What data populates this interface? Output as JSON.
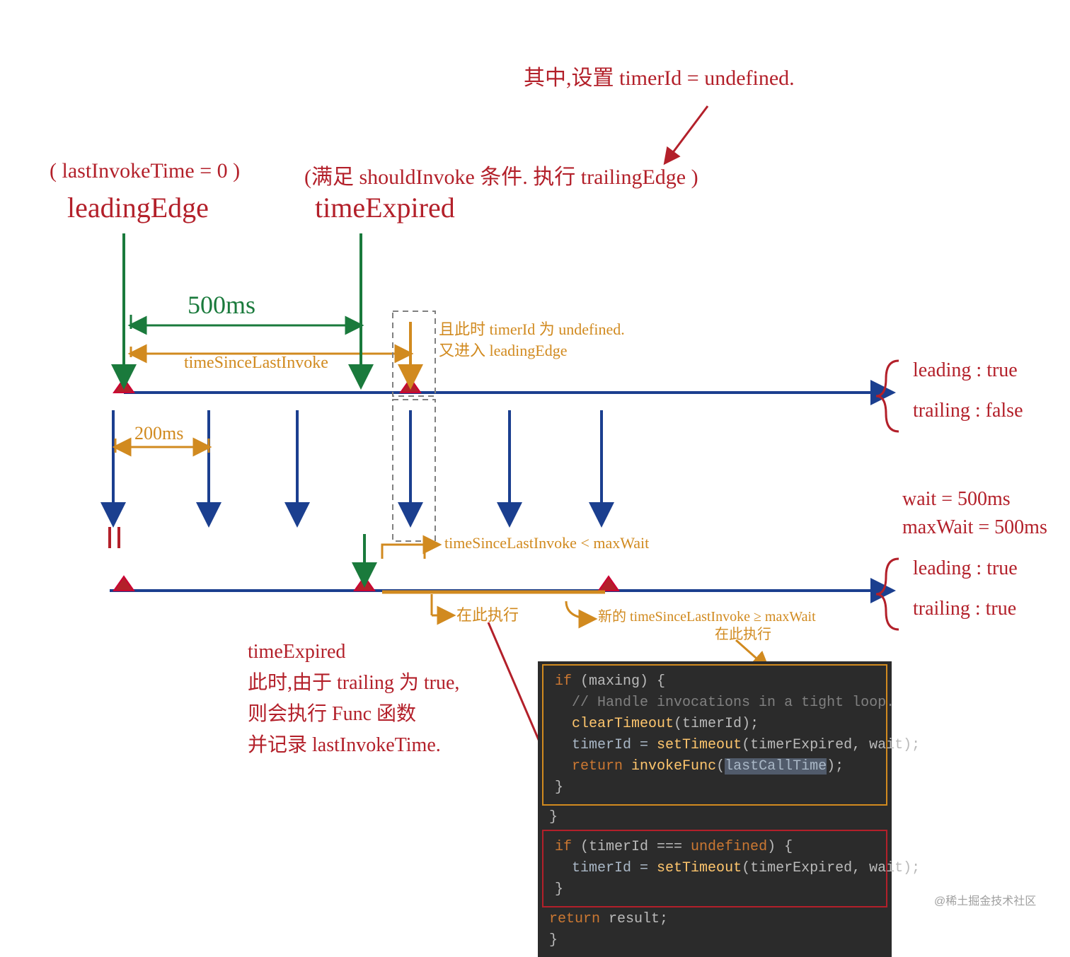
{
  "annotations": {
    "top_right": "其中,设置 timerId = undefined.",
    "left_cond": "( lastInvokeTime = 0 )",
    "leading_edge": "leadingEdge",
    "mid_cond": "(满足 shouldInvoke 条件. 执行 trailingEdge )",
    "time_expired": "timeExpired",
    "duration_500": "500ms",
    "since_invoke": "timeSinceLastInvoke",
    "orange_top_1": "且此时 timerId 为 undefined.",
    "orange_top_2": "又进入 leadingEdge",
    "duration_200": "200ms",
    "since_lt_max": "timeSinceLastInvoke < maxWait",
    "exec_here_1": "在此执行",
    "since_ge_max": "新的 timeSinceLastInvoke ≥ maxWait",
    "exec_here_2": "在此执行",
    "bottom_note": "timeExpired\n此时,由于 trailing 为 true,\n则会执行 Func 函数\n并记录 lastInvokeTime.",
    "brace_top_1": "leading : true",
    "brace_top_2": "trailing : false",
    "wait_line": "wait = 500ms",
    "maxwait_line": "maxWait = 500ms",
    "brace_bot_1": "leading : true",
    "brace_bot_2": "trailing : true"
  },
  "code": {
    "l1_if": "if",
    "l1_rest": " (maxing) {",
    "l2": "// Handle invocations in a tight loop.",
    "l3_fn": "clearTimeout",
    "l3_rest": "(timerId);",
    "l4_a": "timerId = ",
    "l4_fn": "setTimeout",
    "l4_b": "(timerExpired, wait);",
    "l5_ret": "return",
    "l5_sp": " ",
    "l5_fn": "invokeFunc",
    "l5_open": "(",
    "l5_arg": "lastCallTime",
    "l5_close": ");",
    "l6": "}",
    "l7": "}",
    "l8_if": "if",
    "l8_rest": " (timerId === ",
    "l8_undef": "undefined",
    "l8_tail": ") {",
    "l9_a": "timerId = ",
    "l9_fn": "setTimeout",
    "l9_b": "(timerExpired, wait);",
    "l10": "}",
    "l11_ret": "return",
    "l11_rest": " result;",
    "l12": "}"
  },
  "watermark": "@稀土掘金技术社区"
}
